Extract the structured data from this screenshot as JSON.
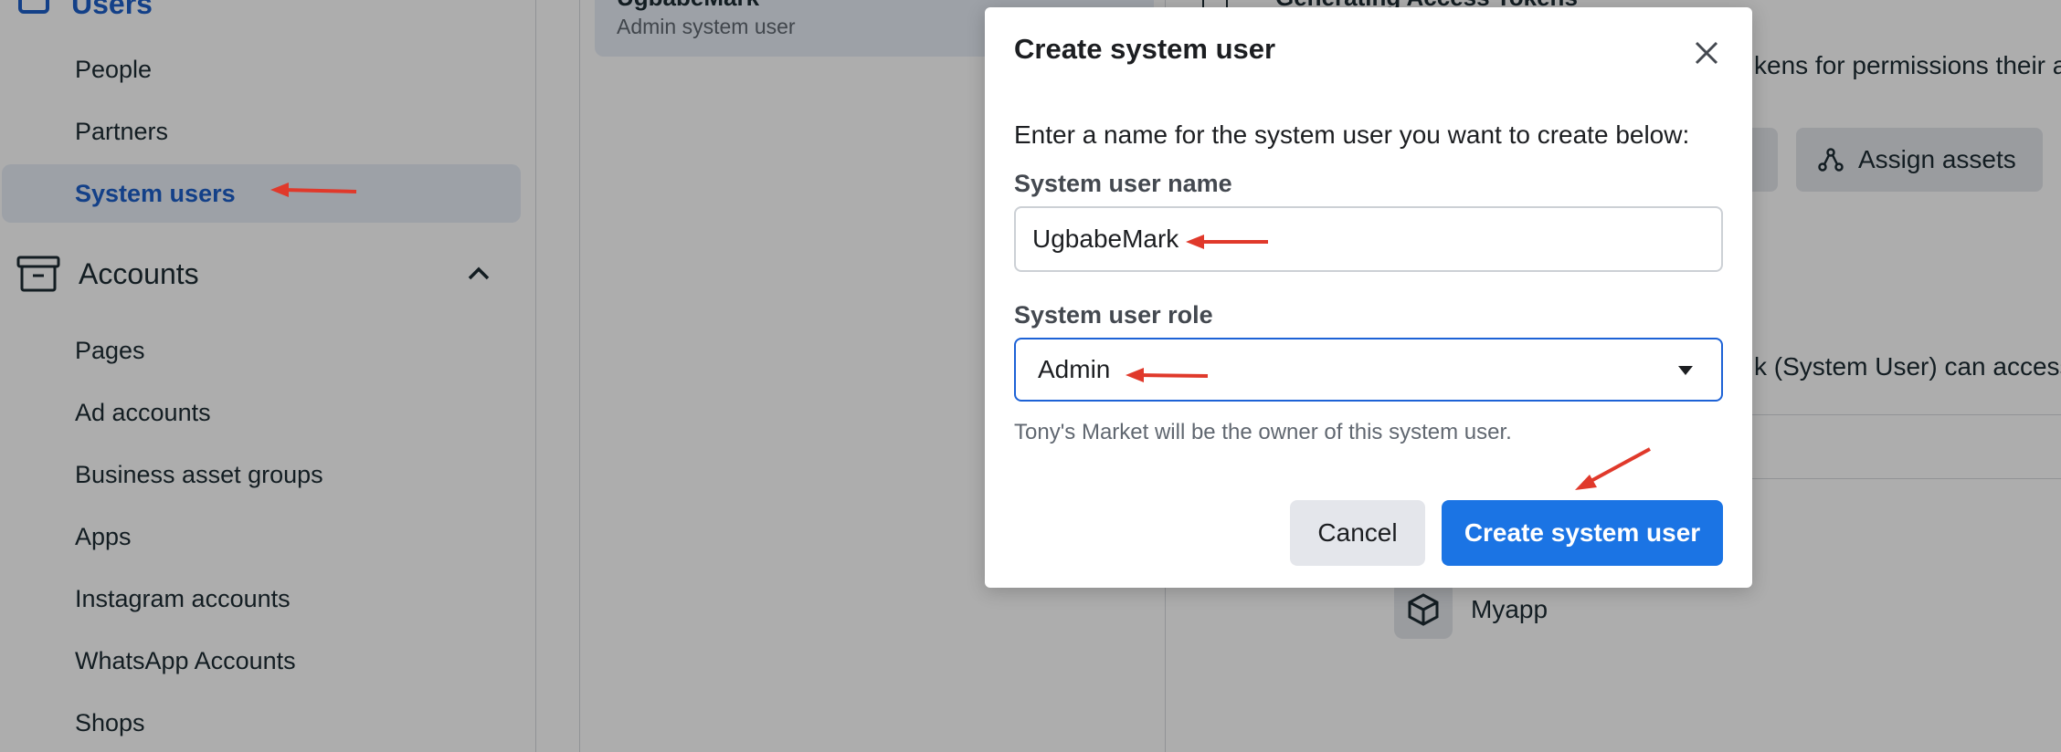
{
  "sidebar": {
    "section_label": "Users",
    "user_items": [
      {
        "label": "People"
      },
      {
        "label": "Partners"
      },
      {
        "label": "System users"
      }
    ],
    "accounts_label": "Accounts",
    "account_items": [
      {
        "label": "Pages"
      },
      {
        "label": "Ad accounts"
      },
      {
        "label": "Business asset groups"
      },
      {
        "label": "Apps"
      },
      {
        "label": "Instagram accounts"
      },
      {
        "label": "WhatsApp Accounts"
      },
      {
        "label": "Shops"
      }
    ]
  },
  "list": {
    "selected_name": "UgbabeMark",
    "selected_sub": "Admin system user"
  },
  "detail": {
    "heading": "Generating Access Tokens",
    "permissions_text": "kens for permissions their a",
    "assign_label": "Assign assets",
    "access_text": "k (System User) can access",
    "app_name": "Myapp"
  },
  "modal": {
    "title": "Create system user",
    "intro": "Enter a name for the system user you want to create below:",
    "name_label": "System user name",
    "name_value": "UgbabeMark",
    "role_label": "System user role",
    "role_value": "Admin",
    "note": "Tony's Market will be the owner of this system user.",
    "cancel_label": "Cancel",
    "create_label": "Create system user"
  },
  "colors": {
    "primary": "#1b74e4",
    "active_nav_text": "#1d5fc9",
    "annotation_arrow": "#e0392b"
  }
}
